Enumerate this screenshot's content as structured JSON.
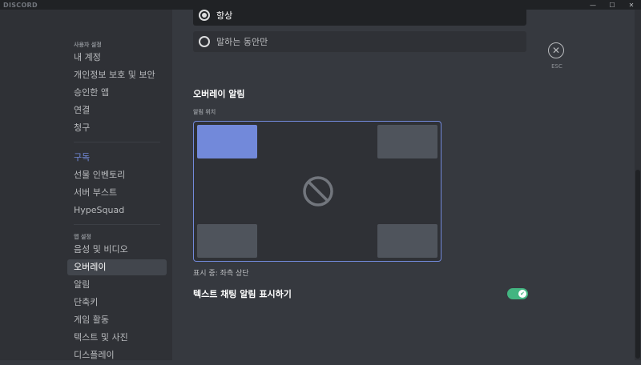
{
  "window": {
    "brand": "DISCORD",
    "controls": {
      "minimize": "—",
      "maximize": "☐",
      "close": "✕"
    }
  },
  "sidebar": {
    "user_settings_header": "사용자 설정",
    "user_items": [
      "내 계정",
      "개인정보 보호 및 보안",
      "승인한 앱",
      "연결",
      "청구"
    ],
    "billing_items": [
      "구독",
      "선물 인벤토리",
      "서버 부스트",
      "HypeSquad"
    ],
    "app_settings_header": "앱 설정",
    "app_items": [
      "음성 및 비디오",
      "오버레이",
      "알림",
      "단축키",
      "게임 활동",
      "텍스트 및 사진",
      "디스플레이"
    ],
    "active_item": "오버레이"
  },
  "overlay": {
    "radio_options": [
      {
        "label": "항상",
        "selected": true
      },
      {
        "label": "말하는 동안만",
        "selected": false
      }
    ],
    "esc_label": "ESC",
    "section_title": "오버레이 알림",
    "position_label": "알림 위치",
    "selected_corner": "top-left",
    "status_text": "표시 중: 좌측 상단",
    "toggle_label": "텍스트 채팅 알림 표시하기",
    "toggle_on": true
  },
  "colors": {
    "accent": "#7289da",
    "toggle_on": "#43b581",
    "sidebar_bg": "#2f3136",
    "content_bg": "#36393f"
  }
}
